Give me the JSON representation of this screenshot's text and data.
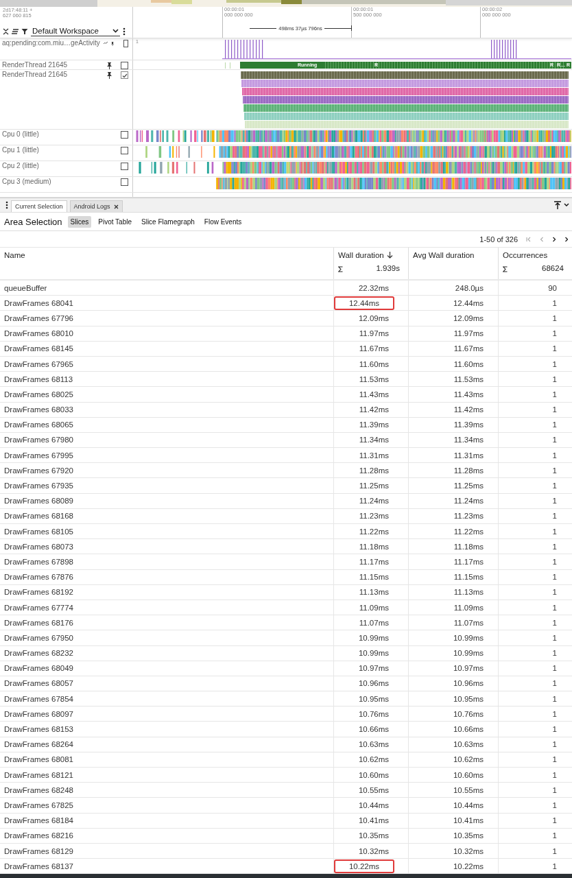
{
  "timeline": {
    "timestamp": [
      "2d17:48:11 +",
      "627 060 815"
    ],
    "workspace": "Default Workspace",
    "ticks": [
      {
        "time": "00:00:01",
        "ns": "000 000 000"
      },
      {
        "time": "00:00:01",
        "ns": "500 000 000"
      },
      {
        "time": "00:00:02",
        "ns": "000 000 000"
      }
    ],
    "span": "498ms 37µs 796ns",
    "tracks": [
      {
        "name": "aq:pending:com.miu…geActivity",
        "kind": "counter",
        "value": "1",
        "checked": false
      },
      {
        "name": "RenderThread 21645",
        "kind": "thread",
        "checked": false,
        "slices": [
          "Running",
          "R",
          "R",
          "R…",
          "R"
        ]
      },
      {
        "name": "RenderThread 21645",
        "kind": "slices",
        "checked": true
      },
      {
        "name": "Cpu 0 (little)",
        "kind": "cpu",
        "checked": false
      },
      {
        "name": "Cpu 1 (little)",
        "kind": "cpu",
        "checked": false
      },
      {
        "name": "Cpu 2 (little)",
        "kind": "cpu",
        "checked": false
      },
      {
        "name": "Cpu 3 (medium)",
        "kind": "cpu",
        "checked": false
      }
    ]
  },
  "panel": {
    "tabs": [
      {
        "label": "Current Selection",
        "selected": true,
        "closable": false
      },
      {
        "label": "Android Logs",
        "selected": false,
        "closable": true
      }
    ],
    "title": "Area Selection",
    "subtabs": [
      {
        "label": "Slices",
        "selected": true
      },
      {
        "label": "Pivot Table",
        "selected": false
      },
      {
        "label": "Slice Flamegraph",
        "selected": false
      },
      {
        "label": "Flow Events",
        "selected": false
      }
    ],
    "pager": "1-50 of 326",
    "table": {
      "columns": [
        {
          "label": "Name"
        },
        {
          "label": "Wall duration",
          "sorted": true,
          "sum": "1.939s"
        },
        {
          "label": "Avg Wall duration"
        },
        {
          "label": "Occurrences",
          "sum": "68624"
        }
      ],
      "rows": [
        {
          "name": "queueBuffer",
          "wall": "22.32ms",
          "avg": "248.0µs",
          "occ": "90",
          "highlighted": false
        },
        {
          "name": "DrawFrames 68041",
          "wall": "12.44ms",
          "avg": "12.44ms",
          "occ": "1",
          "highlighted": true
        },
        {
          "name": "DrawFrames 67796",
          "wall": "12.09ms",
          "avg": "12.09ms",
          "occ": "1",
          "highlighted": false
        },
        {
          "name": "DrawFrames 68010",
          "wall": "11.97ms",
          "avg": "11.97ms",
          "occ": "1",
          "highlighted": false
        },
        {
          "name": "DrawFrames 68145",
          "wall": "11.67ms",
          "avg": "11.67ms",
          "occ": "1",
          "highlighted": false
        },
        {
          "name": "DrawFrames 67965",
          "wall": "11.60ms",
          "avg": "11.60ms",
          "occ": "1",
          "highlighted": false
        },
        {
          "name": "DrawFrames 68113",
          "wall": "11.53ms",
          "avg": "11.53ms",
          "occ": "1",
          "highlighted": false
        },
        {
          "name": "DrawFrames 68025",
          "wall": "11.43ms",
          "avg": "11.43ms",
          "occ": "1",
          "highlighted": false
        },
        {
          "name": "DrawFrames 68033",
          "wall": "11.42ms",
          "avg": "11.42ms",
          "occ": "1",
          "highlighted": false
        },
        {
          "name": "DrawFrames 68065",
          "wall": "11.39ms",
          "avg": "11.39ms",
          "occ": "1",
          "highlighted": false
        },
        {
          "name": "DrawFrames 67980",
          "wall": "11.34ms",
          "avg": "11.34ms",
          "occ": "1",
          "highlighted": false
        },
        {
          "name": "DrawFrames 67995",
          "wall": "11.31ms",
          "avg": "11.31ms",
          "occ": "1",
          "highlighted": false
        },
        {
          "name": "DrawFrames 67920",
          "wall": "11.28ms",
          "avg": "11.28ms",
          "occ": "1",
          "highlighted": false
        },
        {
          "name": "DrawFrames 67935",
          "wall": "11.25ms",
          "avg": "11.25ms",
          "occ": "1",
          "highlighted": false
        },
        {
          "name": "DrawFrames 68089",
          "wall": "11.24ms",
          "avg": "11.24ms",
          "occ": "1",
          "highlighted": false
        },
        {
          "name": "DrawFrames 68168",
          "wall": "11.23ms",
          "avg": "11.23ms",
          "occ": "1",
          "highlighted": false
        },
        {
          "name": "DrawFrames 68105",
          "wall": "11.22ms",
          "avg": "11.22ms",
          "occ": "1",
          "highlighted": false
        },
        {
          "name": "DrawFrames 68073",
          "wall": "11.18ms",
          "avg": "11.18ms",
          "occ": "1",
          "highlighted": false
        },
        {
          "name": "DrawFrames 67898",
          "wall": "11.17ms",
          "avg": "11.17ms",
          "occ": "1",
          "highlighted": false
        },
        {
          "name": "DrawFrames 67876",
          "wall": "11.15ms",
          "avg": "11.15ms",
          "occ": "1",
          "highlighted": false
        },
        {
          "name": "DrawFrames 68192",
          "wall": "11.13ms",
          "avg": "11.13ms",
          "occ": "1",
          "highlighted": false
        },
        {
          "name": "DrawFrames 67774",
          "wall": "11.09ms",
          "avg": "11.09ms",
          "occ": "1",
          "highlighted": false
        },
        {
          "name": "DrawFrames 68176",
          "wall": "11.07ms",
          "avg": "11.07ms",
          "occ": "1",
          "highlighted": false
        },
        {
          "name": "DrawFrames 67950",
          "wall": "10.99ms",
          "avg": "10.99ms",
          "occ": "1",
          "highlighted": false
        },
        {
          "name": "DrawFrames 68232",
          "wall": "10.99ms",
          "avg": "10.99ms",
          "occ": "1",
          "highlighted": false
        },
        {
          "name": "DrawFrames 68049",
          "wall": "10.97ms",
          "avg": "10.97ms",
          "occ": "1",
          "highlighted": false
        },
        {
          "name": "DrawFrames 68057",
          "wall": "10.96ms",
          "avg": "10.96ms",
          "occ": "1",
          "highlighted": false
        },
        {
          "name": "DrawFrames 67854",
          "wall": "10.95ms",
          "avg": "10.95ms",
          "occ": "1",
          "highlighted": false
        },
        {
          "name": "DrawFrames 68097",
          "wall": "10.76ms",
          "avg": "10.76ms",
          "occ": "1",
          "highlighted": false
        },
        {
          "name": "DrawFrames 68153",
          "wall": "10.66ms",
          "avg": "10.66ms",
          "occ": "1",
          "highlighted": false
        },
        {
          "name": "DrawFrames 68264",
          "wall": "10.63ms",
          "avg": "10.63ms",
          "occ": "1",
          "highlighted": false
        },
        {
          "name": "DrawFrames 68081",
          "wall": "10.62ms",
          "avg": "10.62ms",
          "occ": "1",
          "highlighted": false
        },
        {
          "name": "DrawFrames 68121",
          "wall": "10.60ms",
          "avg": "10.60ms",
          "occ": "1",
          "highlighted": false
        },
        {
          "name": "DrawFrames 68248",
          "wall": "10.55ms",
          "avg": "10.55ms",
          "occ": "1",
          "highlighted": false
        },
        {
          "name": "DrawFrames 67825",
          "wall": "10.44ms",
          "avg": "10.44ms",
          "occ": "1",
          "highlighted": false
        },
        {
          "name": "DrawFrames 68184",
          "wall": "10.41ms",
          "avg": "10.41ms",
          "occ": "1",
          "highlighted": false
        },
        {
          "name": "DrawFrames 68216",
          "wall": "10.35ms",
          "avg": "10.35ms",
          "occ": "1",
          "highlighted": false
        },
        {
          "name": "DrawFrames 68129",
          "wall": "10.32ms",
          "avg": "10.32ms",
          "occ": "1",
          "highlighted": false
        },
        {
          "name": "DrawFrames 68137",
          "wall": "10.22ms",
          "avg": "10.22ms",
          "occ": "1",
          "highlighted": true
        }
      ]
    }
  }
}
